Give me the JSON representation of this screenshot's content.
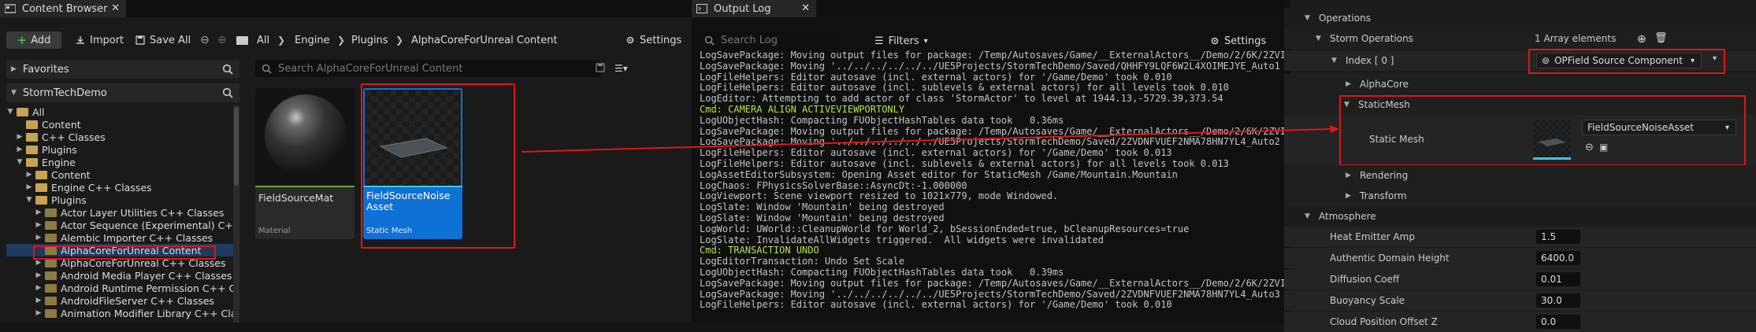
{
  "content_browser": {
    "tab_title": "Content Browser",
    "add_label": "Add",
    "import_label": "Import",
    "save_all_label": "Save All",
    "breadcrumbs": [
      "All",
      "Engine",
      "Plugins",
      "AlphaCoreForUnreal Content"
    ],
    "settings_label": "Settings",
    "favorites_label": "Favorites",
    "project_label": "StormTechDemo",
    "search_placeholder": "Search AlphaCoreForUnreal Content",
    "tree": [
      {
        "label": "All",
        "indent": 0,
        "arrow": "▼"
      },
      {
        "label": "Content",
        "indent": 1,
        "arrow": ""
      },
      {
        "label": "C++ Classes",
        "indent": 1,
        "arrow": "▶"
      },
      {
        "label": "Plugins",
        "indent": 1,
        "arrow": "▶"
      },
      {
        "label": "Engine",
        "indent": 1,
        "arrow": "▼"
      },
      {
        "label": "Content",
        "indent": 2,
        "arrow": "▶"
      },
      {
        "label": "Engine C++ Classes",
        "indent": 2,
        "arrow": "▶"
      },
      {
        "label": "Plugins",
        "indent": 2,
        "arrow": "▼"
      },
      {
        "label": "Actor Layer Utilities C++ Classes",
        "indent": 3,
        "arrow": "▶"
      },
      {
        "label": "Actor Sequence (Experimental) C++ Cla",
        "indent": 3,
        "arrow": "▶"
      },
      {
        "label": "Alembic Importer C++ Classes",
        "indent": 3,
        "arrow": "▶"
      },
      {
        "label": "AlphaCoreForUnreal Content",
        "indent": 3,
        "arrow": "",
        "selected": true
      },
      {
        "label": "AlphaCoreForUnreal C++ Classes",
        "indent": 3,
        "arrow": "▶"
      },
      {
        "label": "Android Media Player C++ Classes",
        "indent": 3,
        "arrow": "▶"
      },
      {
        "label": "Android Runtime Permission C++ Class",
        "indent": 3,
        "arrow": "▶"
      },
      {
        "label": "AndroidFileServer C++ Classes",
        "indent": 3,
        "arrow": "▶"
      },
      {
        "label": "Animation Modifier Library C++ Classe",
        "indent": 3,
        "arrow": "▶"
      }
    ],
    "assets": [
      {
        "name": "FieldSourceMat",
        "type": "Material"
      },
      {
        "name": "FieldSourceNoise Asset",
        "type": "Static Mesh"
      }
    ]
  },
  "output_log": {
    "tab_title": "Output Log",
    "search_placeholder": "Search Log",
    "filters_label": "Filters",
    "settings_label": "Settings",
    "lines": [
      {
        "text": "LogSavePackage: Moving output files for package: /Temp/Autosaves/Game/__ExternalActors__/Demo/2/6K/2ZVI",
        "cmd": false
      },
      {
        "text": "LogSavePackage: Moving '../../../../../../UE5Projects/StormTechDemo/Saved/QHHFY9LQF6W2L4XOIMEJYE_Auto1",
        "cmd": false
      },
      {
        "text": "LogFileHelpers: Editor autosave (incl. external actors) for '/Game/Demo' took 0.010",
        "cmd": false
      },
      {
        "text": "LogFileHelpers: Editor autosave (incl. sublevels & external actors) for all levels took 0.010",
        "cmd": false
      },
      {
        "text": "LogEditor: Attempting to add actor of class 'StormActor' to level at 1944.13,-5729.39,373.54",
        "cmd": false
      },
      {
        "text": "Cmd: CAMERA ALIGN ACTIVEVIEWPORTONLY",
        "cmd": true
      },
      {
        "text": "LogUObjectHash: Compacting FUObjectHashTables data took   0.36ms",
        "cmd": false
      },
      {
        "text": "LogSavePackage: Moving output files for package: /Temp/Autosaves/Game/__ExternalActors__/Demo/2/6K/2ZVI",
        "cmd": false
      },
      {
        "text": "LogSavePackage: Moving '../../../../../../UE5Projects/StormTechDemo/Saved/2ZVDNFVUEF2NMA78HN7YL4_Auto2",
        "cmd": false
      },
      {
        "text": "LogFileHelpers: Editor autosave (incl. external actors) for '/Game/Demo' took 0.013",
        "cmd": false
      },
      {
        "text": "LogFileHelpers: Editor autosave (incl. sublevels & external actors) for all levels took 0.013",
        "cmd": false
      },
      {
        "text": "LogAssetEditorSubsystem: Opening Asset editor for StaticMesh /Game/Mountain.Mountain",
        "cmd": false
      },
      {
        "text": "LogChaos: FPhysicsSolverBase::AsyncDt:-1.000000",
        "cmd": false
      },
      {
        "text": "LogViewport: Scene viewport resized to 1021x779, mode Windowed.",
        "cmd": false
      },
      {
        "text": "LogSlate: Window 'Mountain' being destroyed",
        "cmd": false
      },
      {
        "text": "LogSlate: Window 'Mountain' being destroyed",
        "cmd": false
      },
      {
        "text": "LogWorld: UWorld::CleanupWorld for World_2, bSessionEnded=true, bCleanupResources=true",
        "cmd": false
      },
      {
        "text": "LogSlate: InvalidateAllWidgets triggered.  All widgets were invalidated",
        "cmd": false
      },
      {
        "text": "Cmd: TRANSACTION UNDO",
        "cmd": true
      },
      {
        "text": "LogEditorTransaction: Undo Set Scale",
        "cmd": false
      },
      {
        "text": "LogUObjectHash: Compacting FUObjectHashTables data took   0.39ms",
        "cmd": false
      },
      {
        "text": "LogSavePackage: Moving output files for package: /Temp/Autosaves/Game/__ExternalActors__/Demo/2/6K/2ZVI",
        "cmd": false
      },
      {
        "text": "LogSavePackage: Moving '../../../../../../UE5Projects/StormTechDemo/Saved/2ZVDNFVUEF2NMA78HN7YL4_Auto3",
        "cmd": false
      },
      {
        "text": "LogFileHelpers: Editor autosave (incl. external actors) for '/Game/Demo' took 0.010",
        "cmd": false
      }
    ]
  },
  "details": {
    "operations_label": "Operations",
    "storm_operations_label": "Storm Operations",
    "array_count": "1 Array elements",
    "index_label": "Index [ 0 ]",
    "index_value": "OPField Source Component",
    "alphacore_label": "AlphaCore",
    "staticmesh_label": "StaticMesh",
    "static_mesh_prop_label": "Static Mesh",
    "static_mesh_value": "FieldSourceNoiseAsset",
    "rendering_label": "Rendering",
    "transform_label": "Transform",
    "atmosphere_label": "Atmosphere",
    "props": [
      {
        "label": "Heat Emitter Amp",
        "value": "1.5"
      },
      {
        "label": "Authentic Domain Height",
        "value": "6400.0"
      },
      {
        "label": "Diffusion Coeff",
        "value": "0.01"
      },
      {
        "label": "Buoyancy Scale",
        "value": "30.0"
      },
      {
        "label": "Cloud Position Offset Z",
        "value": "0.0"
      }
    ]
  }
}
